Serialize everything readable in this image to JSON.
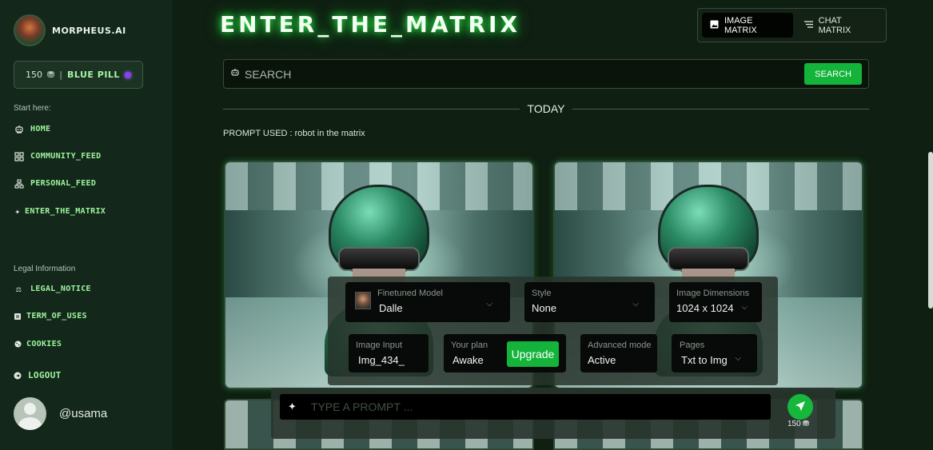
{
  "sidebar": {
    "brand_name": "MORPHEUS.AI",
    "credits": {
      "amount": "150",
      "separator": "|",
      "pill": "BLUE PILL"
    },
    "start_label": "Start here:",
    "nav": [
      {
        "label": "HOME",
        "icon": "robot-icon"
      },
      {
        "label": "COMMUNITY_FEED",
        "icon": "grid-icon"
      },
      {
        "label": "PERSONAL_FEED",
        "icon": "sitemap-icon"
      },
      {
        "label": "ENTER_THE_MATRIX",
        "icon": "sparkle-icon"
      }
    ],
    "legal_label": "Legal Information",
    "legal": [
      {
        "label": "LEGAL_NOTICE",
        "icon": "scale-icon"
      },
      {
        "label": "TERM_OF_USES",
        "icon": "document-icon"
      },
      {
        "label": "COOKIES",
        "icon": "cookie-icon"
      }
    ],
    "logout": "LOGOUT",
    "user_handle": "@usama"
  },
  "header": {
    "title": "ENTER_THE_MATRIX",
    "modes": [
      {
        "label": "IMAGE MATRIX",
        "active": true
      },
      {
        "label": "CHAT MATRIX",
        "active": false
      }
    ]
  },
  "search": {
    "placeholder": "SEARCH",
    "button": "SEARCH"
  },
  "feed": {
    "divider": "TODAY",
    "prompt_used": "PROMPT USED : robot in the matrix"
  },
  "controls": {
    "model": {
      "label": "Finetuned Model",
      "value": "Dalle"
    },
    "style": {
      "label": "Style",
      "value": "None"
    },
    "dimensions": {
      "label": "Image Dimensions",
      "value": "1024 x 1024"
    },
    "image_input": {
      "label": "Image Input",
      "value": "Img_434_"
    },
    "plan": {
      "label": "Your plan",
      "value": "Awake",
      "upgrade": "Upgrade"
    },
    "advanced": {
      "label": "Advanced mode",
      "value": "Active"
    },
    "pages": {
      "label": "Pages",
      "value": "Txt to Img"
    }
  },
  "prompt": {
    "placeholder": "TYPE A PROMPT ...",
    "cost": "150"
  },
  "colors": {
    "accent": "#14b33a",
    "neon_text": "#9ff59f",
    "sidebar_bg": "#13281a"
  }
}
